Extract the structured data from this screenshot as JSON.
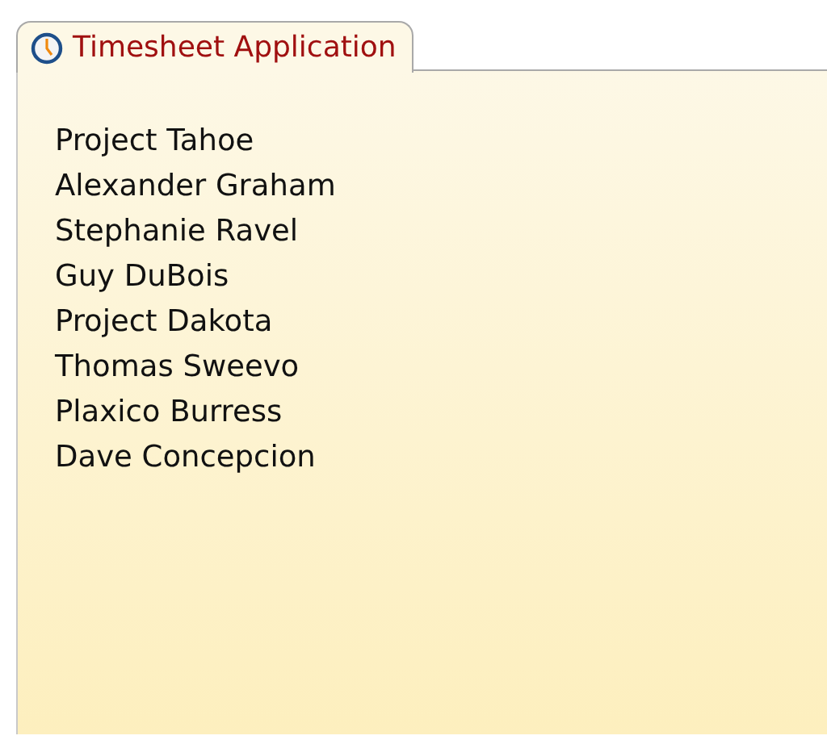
{
  "tab": {
    "title": "Timesheet Application",
    "selected": true
  },
  "items": [
    "Project Tahoe",
    "Alexander Graham",
    "Stephanie Ravel",
    "Guy DuBois",
    "Project Dakota",
    "Thomas Sweevo",
    "Plaxico Burress",
    "Dave Concepcion"
  ]
}
